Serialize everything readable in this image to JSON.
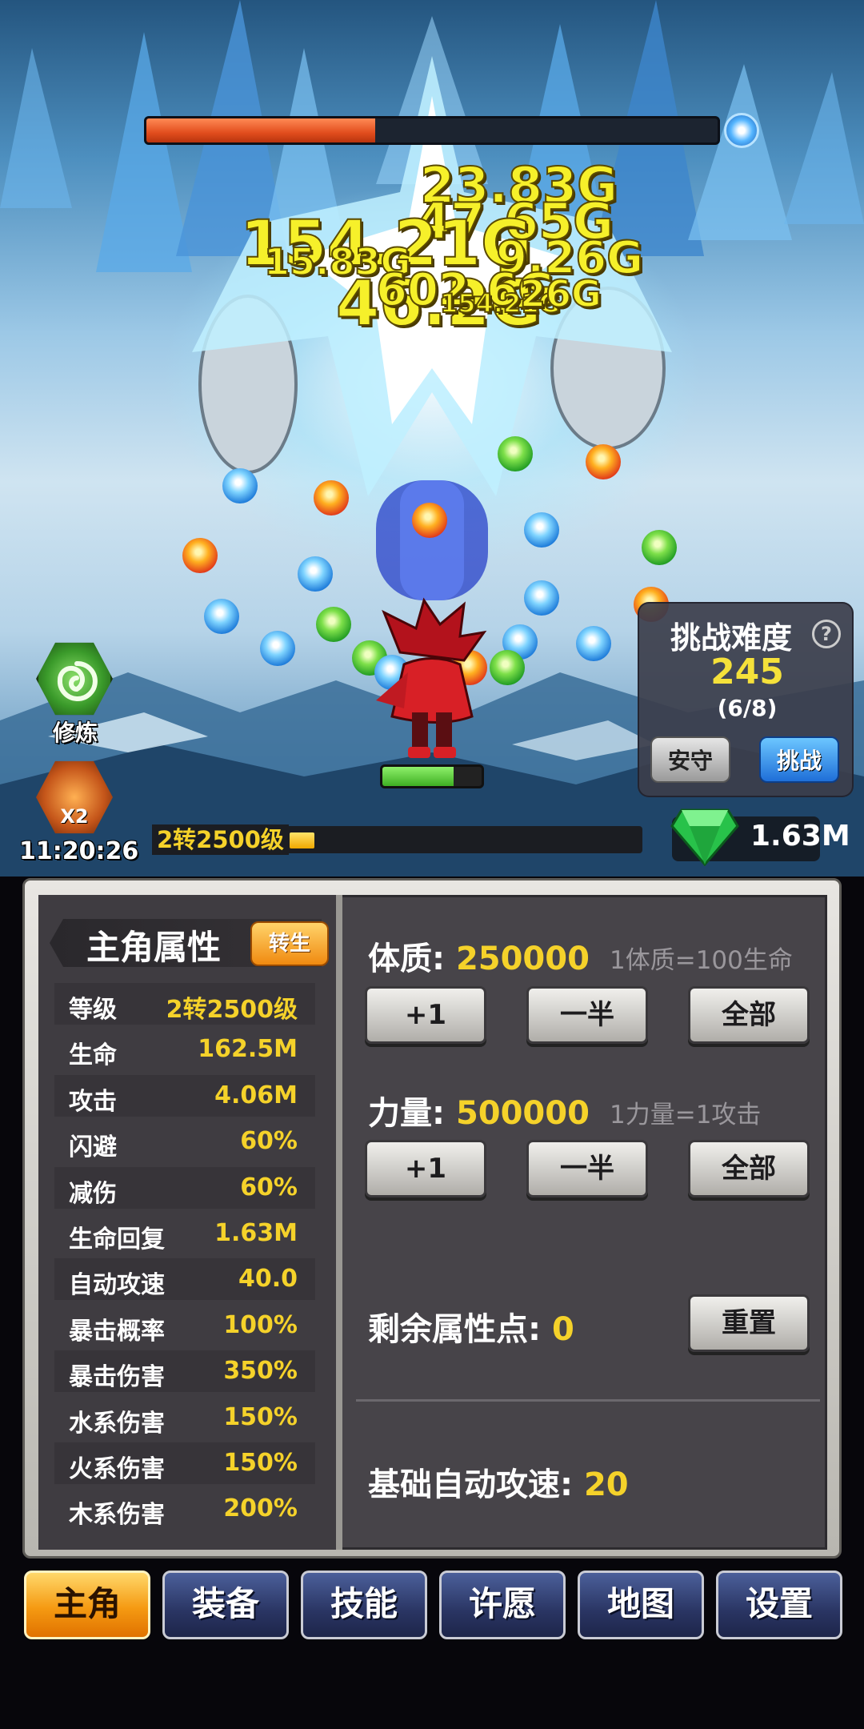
{
  "battle": {
    "boss_hp_fraction": 0.4,
    "damage_numbers": [
      "23.83G",
      "47.65G",
      "154.21G",
      "15.83G",
      "46.2G",
      "9.26G",
      "602.6G",
      "154.21G",
      "26G"
    ],
    "hero_hp_fraction": 0.72
  },
  "side_buttons": {
    "cultivate_label": "修炼",
    "boost_label": "X2",
    "boost_timer": "11:20:26"
  },
  "challenge": {
    "title": "挑战难度",
    "help": "?",
    "level": "245",
    "progress": "(6/8)",
    "stay_label": "安守",
    "challenge_label": "挑战"
  },
  "level_bar": {
    "label": "2转2500级",
    "fill_fraction": 0.05
  },
  "currency": {
    "gems": "1.63M"
  },
  "hero_panel": {
    "title": "主角属性",
    "rebirth_label": "转生",
    "stats": [
      {
        "name": "等级",
        "value": "2转2500级"
      },
      {
        "name": "生命",
        "value": "162.5M"
      },
      {
        "name": "攻击",
        "value": "4.06M"
      },
      {
        "name": "闪避",
        "value": "60%"
      },
      {
        "name": "减伤",
        "value": "60%"
      },
      {
        "name": "生命回复",
        "value": "1.63M"
      },
      {
        "name": "自动攻速",
        "value": "40.0"
      },
      {
        "name": "暴击概率",
        "value": "100%"
      },
      {
        "name": "暴击伤害",
        "value": "350%"
      },
      {
        "name": "水系伤害",
        "value": "150%"
      },
      {
        "name": "火系伤害",
        "value": "150%"
      },
      {
        "name": "木系伤害",
        "value": "200%"
      }
    ],
    "constitution": {
      "label": "体质:",
      "value": "250000",
      "hint": "1体质=100生命"
    },
    "strength": {
      "label": "力量:",
      "value": "500000",
      "hint": "1力量=1攻击"
    },
    "buttons": {
      "plus_one": "+1",
      "half": "一半",
      "all": "全部"
    },
    "remaining": {
      "label": "剩余属性点:",
      "value": "0"
    },
    "reset_label": "重置",
    "base_speed": {
      "label": "基础自动攻速:",
      "value": "20"
    }
  },
  "nav": {
    "tabs": [
      "主角",
      "装备",
      "技能",
      "许愿",
      "地图",
      "设置"
    ],
    "active_index": 0
  },
  "colors": {
    "accent_yellow": "#f5d22a",
    "panel_bg": "#474449",
    "nav_active": "#f59a12",
    "nav_inactive": "#2a3563"
  }
}
